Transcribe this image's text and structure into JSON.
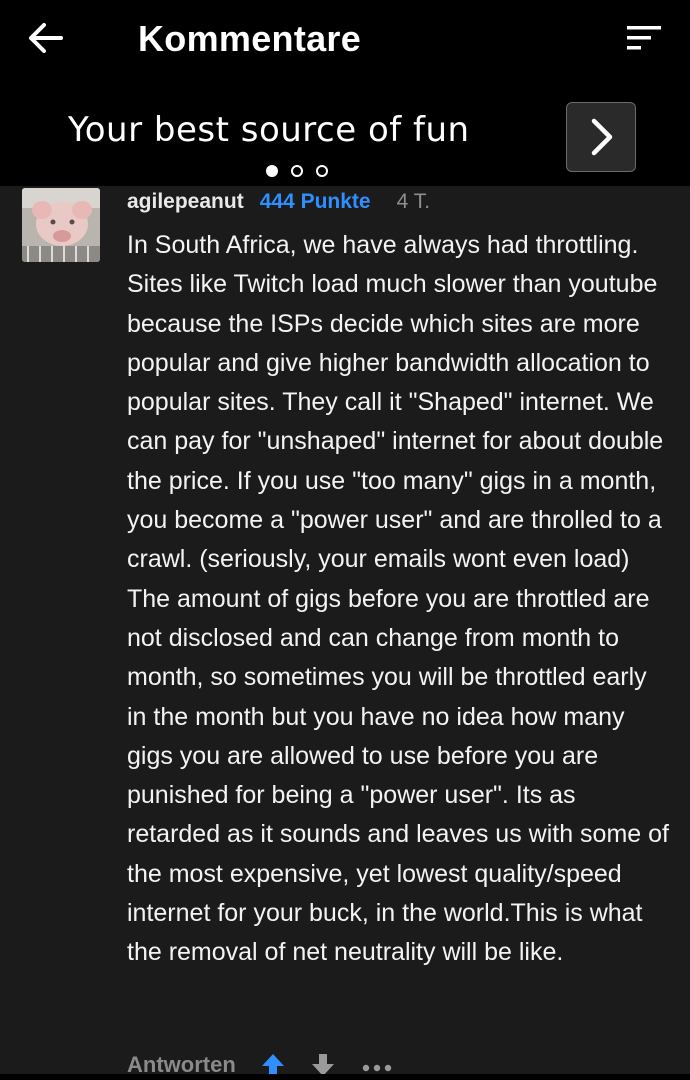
{
  "header": {
    "back_icon": "arrow-left-icon",
    "title": "Kommentare",
    "sort_icon": "sort-icon"
  },
  "banner": {
    "text": "Your best source of fun",
    "next_icon": "chevron-right-icon",
    "page_count": 3,
    "active_page": 1
  },
  "comment": {
    "avatar_icon": "avatar-image",
    "username": "agilepeanut",
    "points": "444 Punkte",
    "age": "4 T.",
    "body": "In South Africa, we have always had throttling. Sites like Twitch load much slower than youtube because the ISPs decide which sites are more popular and give higher bandwidth allocation to popular sites. They call it \"Shaped\" internet. We can pay for \"unshaped\" internet for about double the price. If you use \"too many\" gigs in a month, you become a \"power user\" and are throlled to a crawl. (seriously, your emails wont even load) The amount of gigs before you are throttled are not disclosed and can change from month to month, so sometimes you will be throttled early in the month but you have no idea how many gigs you are allowed to use before you are punished for being a \"power user\". Its as retarded as it sounds and leaves us with some of the most expensive, yet lowest quality/speed internet for your buck, in the world.This is what the removal of net neutrality will be like.",
    "reply_label": "Antworten",
    "upvote_icon": "upvote-arrow-icon",
    "downvote_icon": "downvote-arrow-icon",
    "more_icon": "more-dots-icon"
  },
  "colors": {
    "background": "#1b1b1b",
    "header_background": "#000000",
    "points_blue": "#2f8fff",
    "text_primary": "#f3f3f3",
    "text_secondary": "#8e8e8e"
  }
}
